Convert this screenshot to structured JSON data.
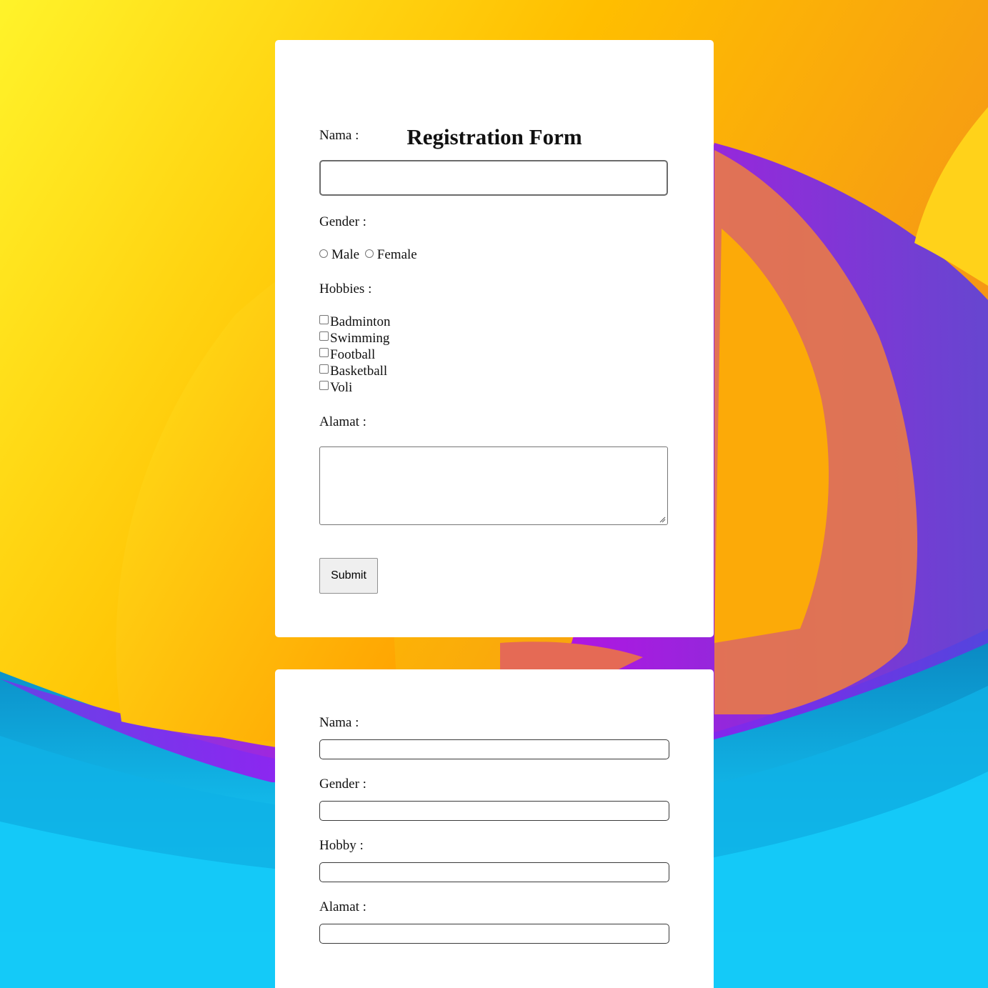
{
  "form": {
    "title": "Registration Form",
    "nama_label": "Nama :",
    "nama_value": "",
    "gender_label": "Gender :",
    "gender_options": [
      "Male",
      "Female"
    ],
    "hobbies_label": "Hobbies :",
    "hobbies": [
      "Badminton",
      "Swimming",
      "Football",
      "Basketball",
      "Voli"
    ],
    "alamat_label": "Alamat :",
    "alamat_value": "",
    "submit_label": "Submit"
  },
  "output": {
    "nama_label": "Nama :",
    "nama_value": "",
    "gender_label": "Gender :",
    "gender_value": "",
    "hobby_label": "Hobby :",
    "hobby_value": "",
    "alamat_label": "Alamat :",
    "alamat_value": ""
  },
  "colors": {
    "background_yellow": "#ffb400",
    "background_orange": "#f39a1d",
    "background_purple": "#b300f5",
    "background_blue": "#12c8f2",
    "card": "#ffffff"
  }
}
